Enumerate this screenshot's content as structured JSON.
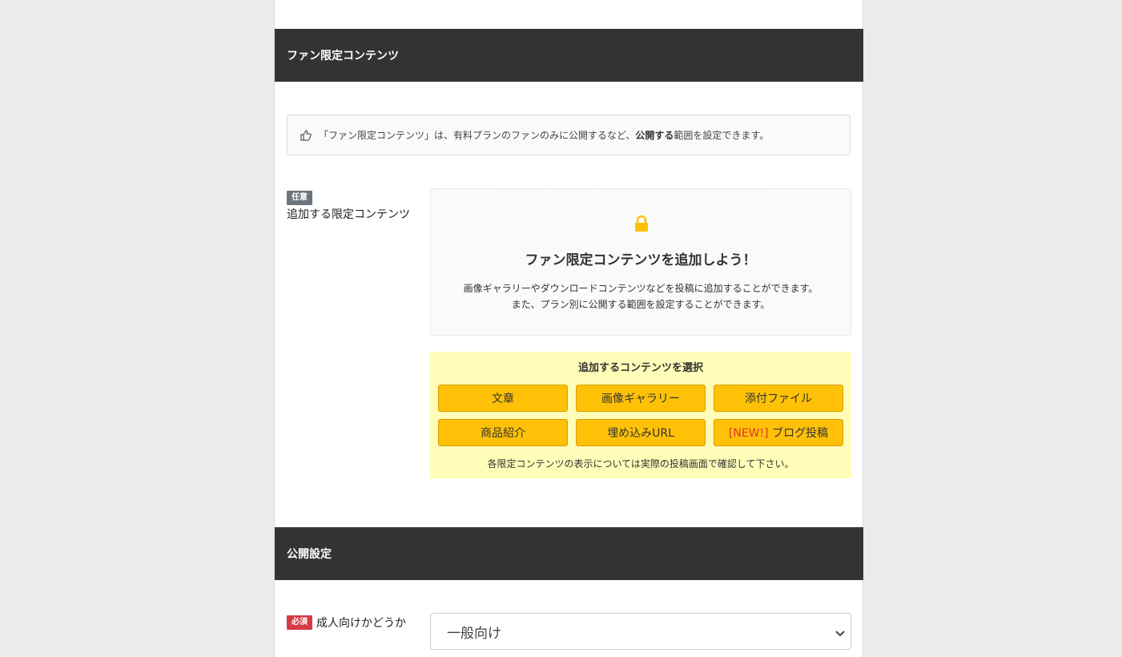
{
  "fan_section": {
    "header": "ファン限定コンテンツ",
    "info_prefix": "「ファン限定コンテンツ」は、有料プランのファンのみに公開するなど、",
    "info_bold": "公開する",
    "info_suffix": "範囲を設定できます。"
  },
  "limited_field": {
    "badge": "任意",
    "label": "追加する限定コンテンツ",
    "empty_title": "ファン限定コンテンツを追加しよう！",
    "empty_desc_1": "画像ギャラリーやダウンロードコンテンツなどを投稿に追加することができます。",
    "empty_desc_2": "また、プラン別に公開する範囲を設定することができます。"
  },
  "content_chooser": {
    "heading": "追加するコンテンツを選択",
    "buttons": [
      {
        "label": "文章"
      },
      {
        "label": "画像ギャラリー"
      },
      {
        "label": "添付ファイル"
      },
      {
        "label": "商品紹介"
      },
      {
        "label": "埋め込みURL"
      },
      {
        "new_tag": "[NEW!]",
        "label": "ブログ投稿"
      }
    ],
    "note": "各限定コンテンツの表示については実際の投稿画面で確認して下さい。"
  },
  "publish_section": {
    "header": "公開設定",
    "badge": "必須",
    "label": "成人向けかどうか",
    "selected": "一般向け"
  },
  "colors": {
    "header_bg": "#333333",
    "button_yellow": "#ffc107",
    "chooser_bg": "#fffdb8",
    "required_red": "#d63a45",
    "optional_gray": "#6c757d",
    "new_red": "#e2342f"
  },
  "icons": {
    "info": "thumbs-up-icon",
    "lock": "lock-icon",
    "select": "chevron-down-icon"
  }
}
